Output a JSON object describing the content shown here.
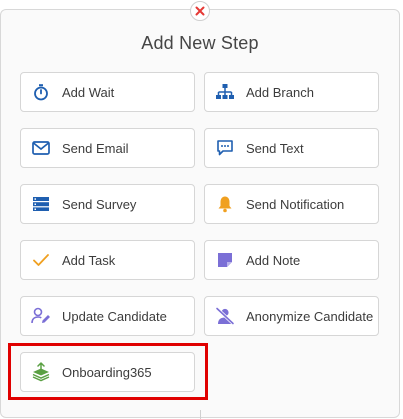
{
  "dialog": {
    "title": "Add New Step",
    "close_icon": "close-x-icon",
    "close_color": "#e53935"
  },
  "steps": [
    {
      "label": "Add Wait",
      "icon": "stopwatch-icon"
    },
    {
      "label": "Add Branch",
      "icon": "branch-icon"
    },
    {
      "label": "Send Email",
      "icon": "envelope-icon"
    },
    {
      "label": "Send Text",
      "icon": "chat-bubble-icon"
    },
    {
      "label": "Send Survey",
      "icon": "survey-list-icon"
    },
    {
      "label": "Send Notification",
      "icon": "bell-icon"
    },
    {
      "label": "Add Task",
      "icon": "checkmark-icon"
    },
    {
      "label": "Add Note",
      "icon": "note-icon"
    },
    {
      "label": "Update Candidate",
      "icon": "user-edit-icon"
    },
    {
      "label": "Anonymize Candidate",
      "icon": "user-slash-icon"
    },
    {
      "label": "Onboarding365",
      "icon": "onboarding-stack-icon"
    }
  ],
  "colors": {
    "icon_blue": "#1f5fb0",
    "icon_orange": "#f0a020",
    "icon_purple": "#7b6fd6",
    "icon_green": "#5aa043",
    "highlight": "#e00000"
  }
}
